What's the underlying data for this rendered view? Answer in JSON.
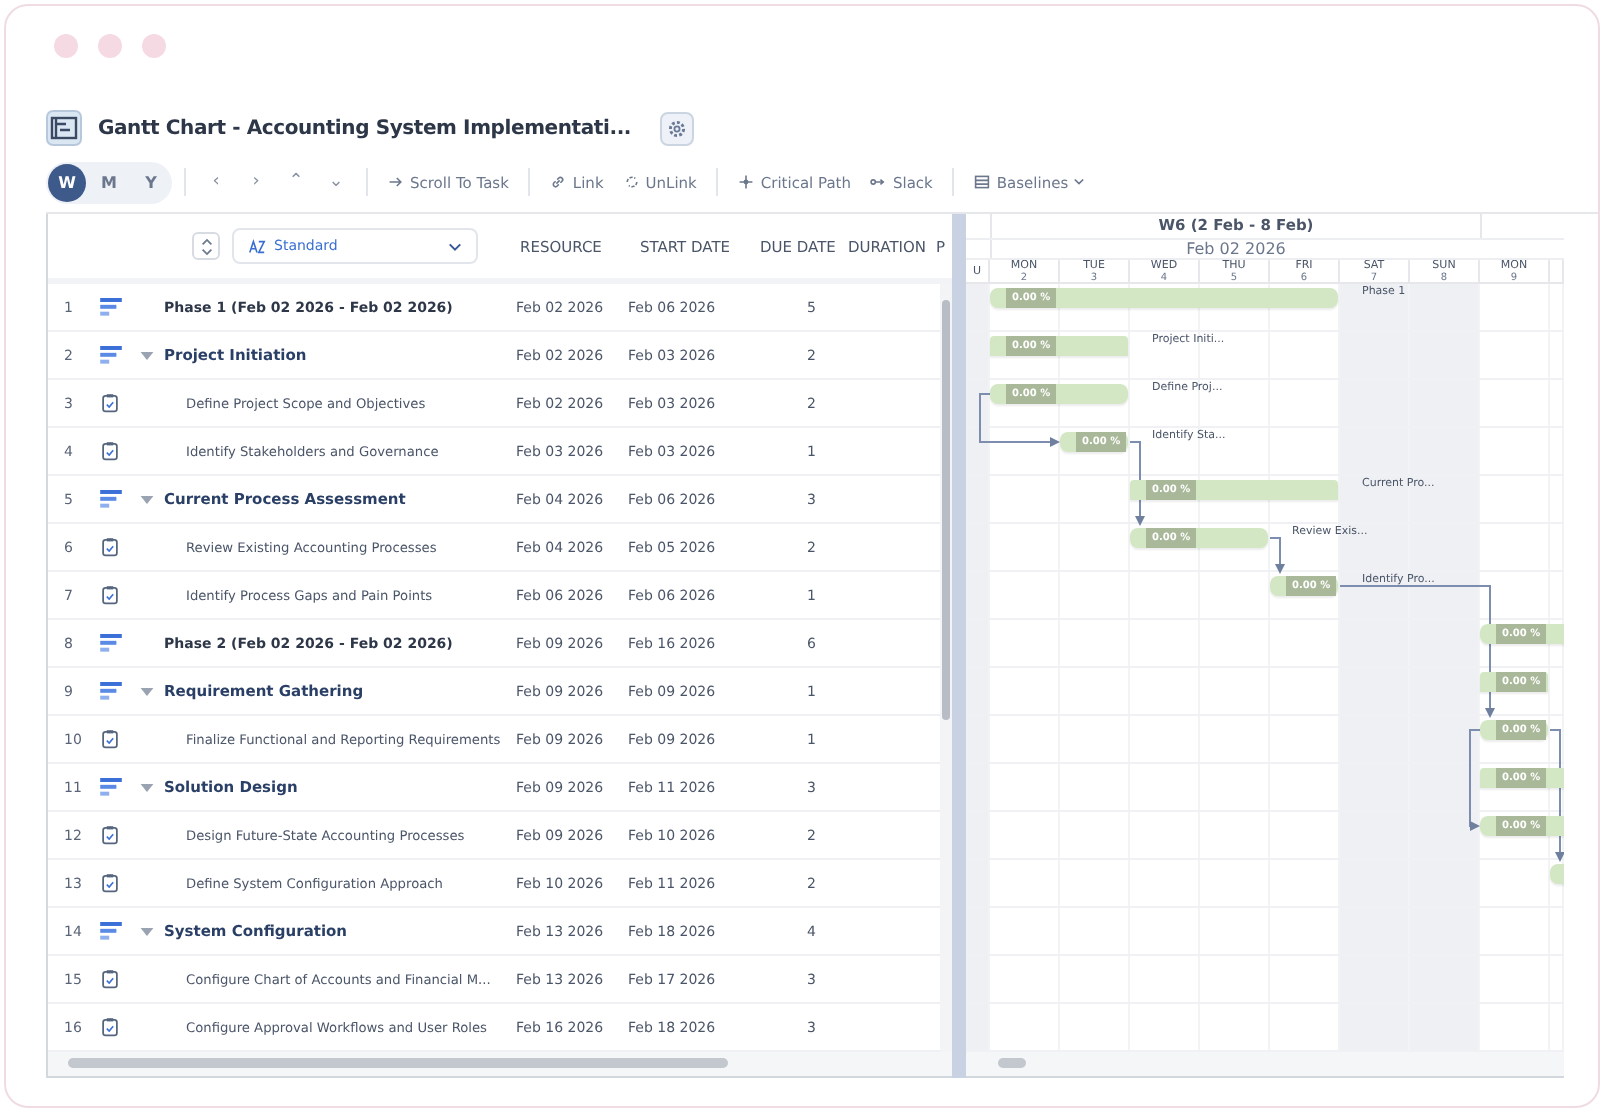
{
  "window": {
    "title": "Gantt Chart - Accounting System Implementati..."
  },
  "view_modes": [
    {
      "label": "W",
      "selected": true
    },
    {
      "label": "M",
      "selected": false
    },
    {
      "label": "Y",
      "selected": false
    }
  ],
  "nav_buttons": [
    {
      "label": "‹"
    },
    {
      "label": "›"
    },
    {
      "label": "⌃"
    },
    {
      "label": "⌄"
    }
  ],
  "toolbar": [
    {
      "kind": "scroll",
      "label": "Scroll To Task"
    },
    {
      "kind": "link",
      "label": "Link"
    },
    {
      "kind": "unlink",
      "label": "UnLink"
    },
    {
      "kind": "critical",
      "label": "Critical Path"
    },
    {
      "kind": "slack",
      "label": "Slack"
    },
    {
      "kind": "baselines",
      "label": "Baselines"
    }
  ],
  "grid": {
    "view_select": "Standard",
    "columns": [
      "RESOURCE",
      "START DATE",
      "DUE DATE",
      "DURATION",
      "P"
    ],
    "rows": [
      {
        "num": "1",
        "kind": "phase",
        "name": "Phase 1 (Feb 02 2026 - Feb 02 2026)",
        "start": "Feb 02 2026",
        "due": "Feb 06 2026",
        "duration": "5",
        "bar": {
          "progress": "0.00 %",
          "label": "Phase 1"
        }
      },
      {
        "num": "2",
        "kind": "group",
        "expanded": true,
        "name": "Project Initiation",
        "start": "Feb 02 2026",
        "due": "Feb 03 2026",
        "duration": "2",
        "bar": {
          "progress": "0.00 %",
          "label": "Project Initi..."
        }
      },
      {
        "num": "3",
        "kind": "task",
        "name": "Define Project Scope and Objectives",
        "start": "Feb 02 2026",
        "due": "Feb 03 2026",
        "duration": "2",
        "bar": {
          "progress": "0.00 %",
          "label": "Define Proj..."
        }
      },
      {
        "num": "4",
        "kind": "task",
        "name": "Identify Stakeholders and Governance",
        "start": "Feb 03 2026",
        "due": "Feb 03 2026",
        "duration": "1",
        "bar": {
          "progress": "0.00 %",
          "label": "Identify Sta..."
        }
      },
      {
        "num": "5",
        "kind": "group",
        "expanded": true,
        "name": "Current Process Assessment",
        "start": "Feb 04 2026",
        "due": "Feb 06 2026",
        "duration": "3",
        "bar": {
          "progress": "0.00 %",
          "label": "Current Pro..."
        }
      },
      {
        "num": "6",
        "kind": "task",
        "name": "Review Existing Accounting Processes",
        "start": "Feb 04 2026",
        "due": "Feb 05 2026",
        "duration": "2",
        "bar": {
          "progress": "0.00 %",
          "label": "Review Exis..."
        }
      },
      {
        "num": "7",
        "kind": "task",
        "name": "Identify Process Gaps and Pain Points",
        "start": "Feb 06 2026",
        "due": "Feb 06 2026",
        "duration": "1",
        "bar": {
          "progress": "0.00 %",
          "label": "Identify Pro..."
        }
      },
      {
        "num": "8",
        "kind": "phase",
        "name": "Phase 2 (Feb 02 2026 - Feb 02 2026)",
        "start": "Feb 09 2026",
        "due": "Feb 16 2026",
        "duration": "6",
        "bar": {
          "progress": "0.00 %"
        }
      },
      {
        "num": "9",
        "kind": "group",
        "expanded": true,
        "name": "Requirement Gathering",
        "start": "Feb 09 2026",
        "due": "Feb 09 2026",
        "duration": "1",
        "bar": {
          "progress": "0.00 %"
        }
      },
      {
        "num": "10",
        "kind": "task",
        "name": "Finalize Functional and Reporting Requirements",
        "start": "Feb 09 2026",
        "due": "Feb 09 2026",
        "duration": "1",
        "bar": {
          "progress": "0.00 %"
        }
      },
      {
        "num": "11",
        "kind": "group",
        "expanded": true,
        "name": "Solution Design",
        "start": "Feb 09 2026",
        "due": "Feb 11 2026",
        "duration": "3",
        "bar": {
          "progress": "0.00 %"
        }
      },
      {
        "num": "12",
        "kind": "task",
        "name": "Design Future-State Accounting Processes",
        "start": "Feb 09 2026",
        "due": "Feb 10 2026",
        "duration": "2",
        "bar": {
          "progress": "0.00 %"
        }
      },
      {
        "num": "13",
        "kind": "task",
        "name": "Define System Configuration Approach",
        "start": "Feb 10 2026",
        "due": "Feb 11 2026",
        "duration": "2",
        "bar": {}
      },
      {
        "num": "14",
        "kind": "group",
        "expanded": true,
        "name": "System Configuration",
        "start": "Feb 13 2026",
        "due": "Feb 18 2026",
        "duration": "4"
      },
      {
        "num": "15",
        "kind": "task",
        "name": "Configure Chart of Accounts and Financial M...",
        "start": "Feb 13 2026",
        "due": "Feb 17 2026",
        "duration": "3"
      },
      {
        "num": "16",
        "kind": "task",
        "name": "Configure Approval Workflows and User Roles",
        "start": "Feb 16 2026",
        "due": "Feb 18 2026",
        "duration": "3"
      }
    ]
  },
  "timeline": {
    "week": "W6 (2 Feb - 8 Feb)",
    "date": "Feb 02 2026",
    "days": [
      {
        "name": "U",
        "weekend": true
      },
      {
        "name": "MON",
        "num": "2",
        "weekend": false
      },
      {
        "name": "TUE",
        "num": "3",
        "weekend": false
      },
      {
        "name": "WED",
        "num": "4",
        "weekend": false
      },
      {
        "name": "THU",
        "num": "5",
        "weekend": false
      },
      {
        "name": "FRI",
        "num": "6",
        "weekend": false
      },
      {
        "name": "SAT",
        "num": "7",
        "weekend": true
      },
      {
        "name": "SUN",
        "num": "8",
        "weekend": true
      },
      {
        "name": "MON",
        "num": "9",
        "weekend": false
      },
      {
        "weekend": false
      }
    ]
  }
}
